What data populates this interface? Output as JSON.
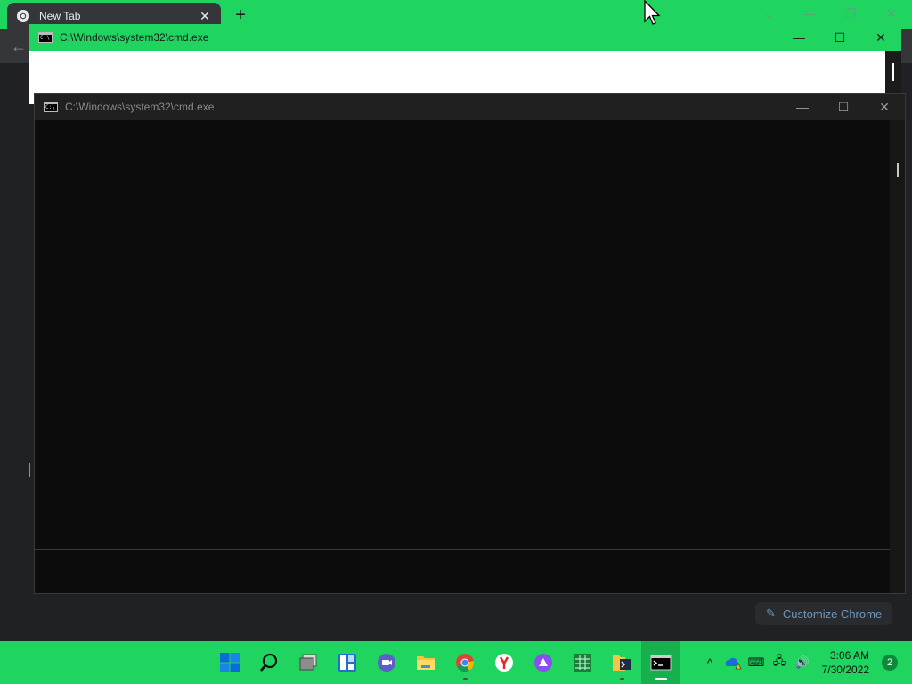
{
  "chrome": {
    "tab_title": "New Tab",
    "tab_close": "✕",
    "new_tab": "+",
    "back": "←",
    "ctrl_tabsearch": "⌄",
    "ctrl_minimize": "—",
    "ctrl_restore": "❐",
    "ctrl_close": "✕",
    "customize_label": "Customize Chrome",
    "customize_icon": "✎"
  },
  "cmd_back": {
    "title": "C:\\Windows\\system32\\cmd.exe",
    "minimize": "—",
    "maximize": "☐",
    "close": "✕"
  },
  "cmd_front": {
    "title": "C:\\Windows\\system32\\cmd.exe",
    "minimize": "—",
    "maximize": "☐",
    "close": "✕"
  },
  "taskbar": {
    "apps": [
      {
        "name": "start",
        "icon": "windows-logo-icon"
      },
      {
        "name": "search",
        "icon": "search-icon"
      },
      {
        "name": "task-view",
        "icon": "task-view-icon"
      },
      {
        "name": "widgets",
        "icon": "widgets-icon"
      },
      {
        "name": "chat",
        "icon": "teams-chat-icon"
      },
      {
        "name": "file-explorer",
        "icon": "folder-icon"
      },
      {
        "name": "chrome",
        "icon": "chrome-icon"
      },
      {
        "name": "yandex",
        "icon": "yandex-icon"
      },
      {
        "name": "alice",
        "icon": "alice-icon"
      },
      {
        "name": "table-app",
        "icon": "spreadsheet-icon"
      },
      {
        "name": "script-tool",
        "icon": "terminal-folder-icon"
      },
      {
        "name": "cmd",
        "icon": "command-prompt-icon"
      }
    ],
    "tray": {
      "chevron": "^",
      "keyboard": "⌨",
      "network": "🖧",
      "volume": "🔊"
    },
    "time": "3:06 AM",
    "date": "7/30/2022",
    "notifications": "2",
    "colors": {
      "taskbar": "#1fd45f",
      "accent": "#1fd45f"
    }
  }
}
